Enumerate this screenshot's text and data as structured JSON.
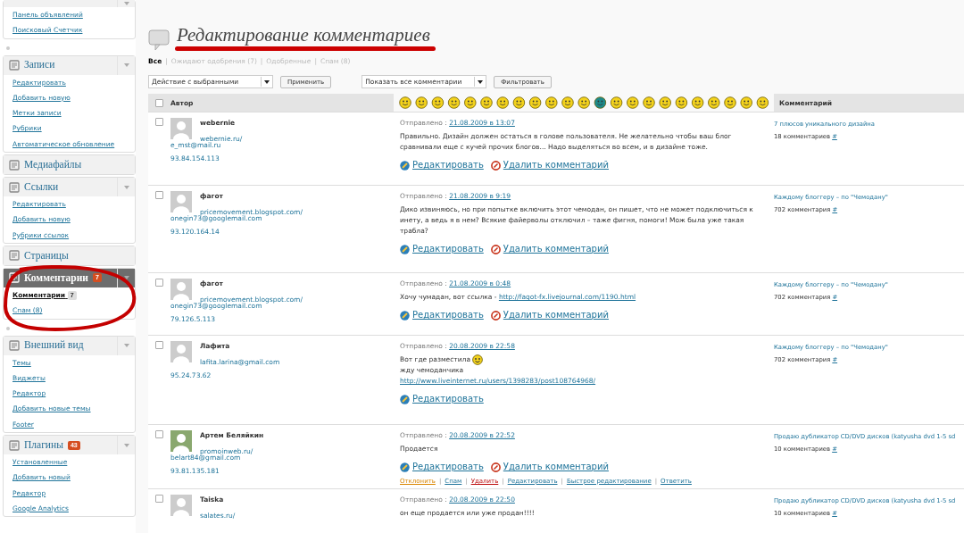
{
  "sidebar": {
    "groups": [
      {
        "active": false,
        "toggle": true,
        "items": [
          {
            "label": "Панель объявлений",
            "selected": false
          },
          {
            "label": "Поисковый Счетчик",
            "selected": false
          }
        ]
      },
      {
        "title": "Записи",
        "active": false,
        "toggle": true,
        "separator": true,
        "items": [
          {
            "label": "Редактировать",
            "selected": false
          },
          {
            "label": "Добавить новую",
            "selected": false
          },
          {
            "label": "Метки записи",
            "selected": false
          },
          {
            "label": "Рубрики",
            "selected": false
          },
          {
            "label": "Автоматическое обновление",
            "selected": false
          }
        ]
      },
      {
        "title": "Медиафайлы",
        "active": false,
        "toggle": false
      },
      {
        "title": "Ссылки",
        "active": false,
        "toggle": true,
        "items": [
          {
            "label": "Редактировать",
            "selected": false
          },
          {
            "label": "Добавить новую",
            "selected": false
          },
          {
            "label": "Рубрики ссылок",
            "selected": false
          }
        ]
      },
      {
        "title": "Страницы",
        "active": false,
        "toggle": false
      },
      {
        "title": "Комментарии",
        "badge": "7",
        "active": true,
        "toggle": true,
        "items": [
          {
            "label": "Комментарии",
            "selected": true,
            "badge": "7"
          },
          {
            "label": "Спам (8)",
            "selected": false
          }
        ]
      },
      {
        "title": "Внешний вид",
        "active": false,
        "toggle": true,
        "separator": true,
        "items": [
          {
            "label": "Темы",
            "selected": false
          },
          {
            "label": "Виджеты",
            "selected": false
          },
          {
            "label": "Редактор",
            "selected": false
          },
          {
            "label": "Добавить новые темы",
            "selected": false
          },
          {
            "label": "Footer",
            "selected": false
          }
        ]
      },
      {
        "title": "Плагины",
        "badge": "43",
        "active": false,
        "toggle": true,
        "items": [
          {
            "label": "Установленные",
            "selected": false
          },
          {
            "label": "Добавить новый",
            "selected": false
          },
          {
            "label": "Редактор",
            "selected": false
          },
          {
            "label": "Google Analytics",
            "selected": false
          }
        ]
      }
    ]
  },
  "page": {
    "title": "Редактирование комментариев",
    "filters": [
      {
        "label": "Все",
        "selected": true
      },
      {
        "label": "Ожидают одобрения (7)",
        "selected": false
      },
      {
        "label": "Одобренные",
        "selected": false
      },
      {
        "label": "Спам (8)",
        "selected": false
      }
    ],
    "filter_separators": [
      "|",
      "|",
      "|"
    ],
    "bulk_action": {
      "value": "Действие с выбранными",
      "button": "Применить"
    },
    "show_filter": {
      "value": "Показать все комментарии",
      "button": "Фильтровать"
    }
  },
  "table": {
    "columns": [
      "Автор",
      "Комментарий"
    ],
    "select_all_checked": false,
    "rows": [
      {
        "checked": false,
        "author": "webernie",
        "has_photo": false,
        "url": "webernie.ru/",
        "email": "e_mst@mail.ru",
        "ip": "93.84.154.113",
        "date_label": "Отправлено :",
        "date": "21.08.2009 в 13:07",
        "lines": [
          [
            {
              "kind": "text",
              "text": "Правильно. Дизайн должен остаться в голове пользователя. Не желательно чтобы ваш блог сравнивали еще с кучей прочих блогов... Надо выделяться во всем, и в дизайне тоже."
            }
          ]
        ],
        "actions": [
          {
            "kind": "edit",
            "label": "Редактировать"
          },
          {
            "kind": "delete",
            "label": "Удалить комментарий"
          }
        ],
        "post": "7 плюсов уникального дизайна",
        "post_count": "18 комментариев",
        "hash": "#"
      },
      {
        "checked": false,
        "author": "фагот",
        "has_photo": false,
        "url": "pricemovement.blogspot.com/",
        "email": "onegin73@googlemail.com",
        "ip": "93.120.164.14",
        "date_label": "Отправлено :",
        "date": "21.08.2009 в 9:19",
        "lines": [
          [
            {
              "kind": "text",
              "text": "Дико извиняюсь, но при попытке включить этот чемодан, он пишет, что не может подключиться к инету, а ведь я в нем? Всякие файерволы отключил – таже фигня, помоги! Мож была уже такая трабла?"
            }
          ]
        ],
        "actions": [
          {
            "kind": "edit",
            "label": "Редактировать"
          },
          {
            "kind": "delete",
            "label": "Удалить комментарий"
          }
        ],
        "post": "Каждому блоггеру – по \"Чемодану\"",
        "post_count": "702 комментария",
        "hash": "#"
      },
      {
        "checked": false,
        "author": "фагот",
        "has_photo": false,
        "url": "pricemovement.blogspot.com/",
        "email": "onegin73@googlemail.com",
        "ip": "79.126.5.113",
        "date_label": "Отправлено :",
        "date": "21.08.2009 в 0:48",
        "lines": [
          [
            {
              "kind": "text",
              "text": "Хочу чумадан, вот ссылка - "
            },
            {
              "kind": "link",
              "text": "http://fagot-fx.livejournal.com/1190.html"
            }
          ]
        ],
        "actions": [
          {
            "kind": "edit",
            "label": "Редактировать"
          },
          {
            "kind": "delete",
            "label": "Удалить комментарий"
          }
        ],
        "post": "Каждому блоггеру – по \"Чемодану\"",
        "post_count": "702 комментария",
        "hash": "#"
      },
      {
        "checked": false,
        "author": "Лафита",
        "has_photo": false,
        "url": "lafita.larina@gmail.com",
        "ip": "95.24.73.62",
        "date_label": "Отправлено :",
        "date": "20.08.2009 в 22:58",
        "lines": [
          [
            {
              "kind": "text",
              "text": "Вот где разместила "
            },
            {
              "kind": "smiley"
            }
          ],
          [
            {
              "kind": "text",
              "text": "жду чемоданчика"
            }
          ],
          [
            {
              "kind": "link",
              "text": "http://www.liveinternet.ru/users/1398283/post108764968/"
            }
          ]
        ],
        "actions": [
          {
            "kind": "edit",
            "label": "Редактировать"
          }
        ],
        "post": "Каждому блоггеру – по \"Чемодану\"",
        "post_count": "702 комментария",
        "hash": "#"
      },
      {
        "checked": false,
        "author": "Артем Беляйкин",
        "has_photo": true,
        "url": "promoinweb.ru/",
        "email": "belart84@gmail.com",
        "ip": "93.81.135.181",
        "date_label": "Отправлено :",
        "date": "20.08.2009 в 22:52",
        "lines": [
          [
            {
              "kind": "text",
              "text": "Продается"
            }
          ]
        ],
        "actions": [
          {
            "kind": "edit",
            "label": "Редактировать"
          },
          {
            "kind": "delete",
            "label": "Удалить комментарий"
          }
        ],
        "row_actions": [
          {
            "kind": "unapprove",
            "label": "Отклонить"
          },
          {
            "kind": "normal",
            "label": "Спам"
          },
          {
            "kind": "delete",
            "label": "Удалить"
          },
          {
            "kind": "normal",
            "label": "Редактировать"
          },
          {
            "kind": "normal",
            "label": "Быстрое редактирование"
          },
          {
            "kind": "normal",
            "label": "Ответить"
          }
        ],
        "row_action_separators": [
          "|",
          "|",
          "|",
          "|",
          "|"
        ],
        "post": "Продаю дубликатор CD/DVD дисков (katyusha dvd 1-5 sd",
        "post_count": "10 комментариев",
        "hash": "#"
      },
      {
        "checked": false,
        "author": "Taiska",
        "has_photo": false,
        "url": "salates.ru/",
        "date_label": "Отправлено :",
        "date": "20.08.2009 в 22:50",
        "lines": [
          [
            {
              "kind": "text",
              "text": "он еще продается или уже продан!!!!"
            }
          ]
        ],
        "post": "Продаю дубликатор CD/DVD дисков (katyusha dvd 1-5 sd",
        "post_count": "10 комментариев",
        "hash": "#"
      }
    ]
  }
}
